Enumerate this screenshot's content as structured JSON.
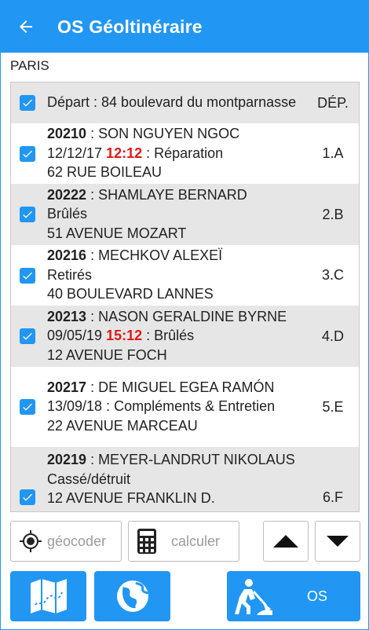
{
  "app": {
    "title": "OS Géoltinéraire"
  },
  "city": "PARIS",
  "depart": {
    "text": "Départ : 84 boulevard du montparnasse",
    "header": "DÉP."
  },
  "items": [
    {
      "code": "20210",
      "name": " : SON NGUYEN NGOC",
      "date": "12/12/17 ",
      "time": "12:12",
      "reason": " : Réparation",
      "address": "62 RUE BOILEAU",
      "dep": "1.A"
    },
    {
      "code": "20222",
      "name": " : SHAMLAYE BERNARD",
      "date": "",
      "time": "",
      "reason": "Brûlés",
      "address": "51 AVENUE MOZART",
      "dep": "2.B"
    },
    {
      "code": "20216",
      "name": " : MECHKOV ALEXEÏ",
      "date": "",
      "time": "",
      "reason": "Retirés",
      "address": "40 BOULEVARD LANNES",
      "dep": "3.C"
    },
    {
      "code": "20213",
      "name": " : NASON GERALDINE BYRNE",
      "date": "09/05/19 ",
      "time": "15:12",
      "reason": " : Brûlés",
      "address": "12 AVENUE FOCH",
      "dep": "4.D"
    },
    {
      "code": "20217",
      "name": " : DE MIGUEL EGEA RAMÓN",
      "date": "13/09/18",
      "time": "",
      "reason": " : Compléments & Entretien",
      "address": "22 AVENUE MARCEAU",
      "dep": "5.E"
    },
    {
      "code": "20219",
      "name": " : MEYER-LANDRUT NIKOLAUS",
      "date": "",
      "time": "",
      "reason": "Cassé/détruit",
      "address": "12 AVENUE FRANKLIN D.",
      "dep": "6.F"
    }
  ],
  "buttons": {
    "geocode": "géocoder",
    "calc": "calculer",
    "os": "OS"
  },
  "colors": {
    "primary": "#2196f3",
    "highlight": "#e01818",
    "row_alt": "#e6e6e6"
  },
  "icons": {
    "back": "arrow-left-icon",
    "geocode": "crosshair-icon",
    "calc": "calculator-icon",
    "up": "triangle-up-icon",
    "down": "triangle-down-icon",
    "map": "map-icon",
    "globe": "globe-icon",
    "worker": "worker-digging-icon"
  }
}
